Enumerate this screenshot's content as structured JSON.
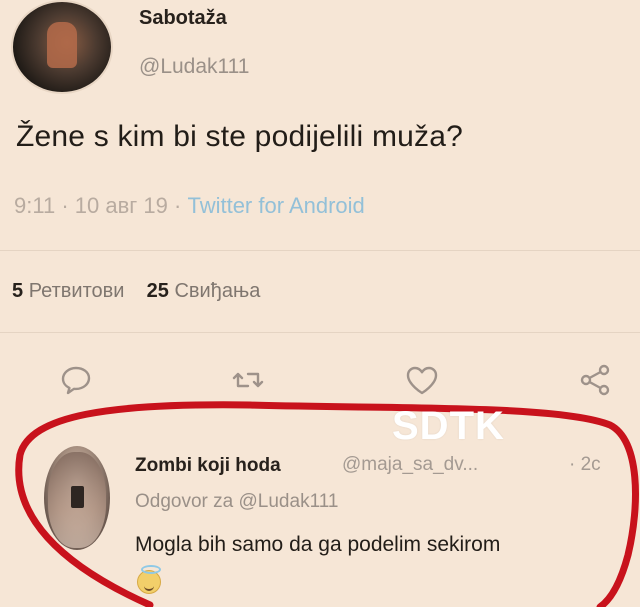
{
  "tweet": {
    "display_name": "Sabotaža",
    "handle": "@Ludak111",
    "text": "Žene s kim bi ste podijelili muža?",
    "time": "9:11",
    "date": "10 авг 19",
    "source": "Twitter for Android",
    "retweets_count": "5",
    "retweets_label": "Ретвитови",
    "likes_count": "25",
    "likes_label": "Свиђања"
  },
  "actions": [
    {
      "icon": "reply-icon"
    },
    {
      "icon": "retweet-icon"
    },
    {
      "icon": "like-icon"
    },
    {
      "icon": "share-icon"
    }
  ],
  "watermark": "SDTK",
  "reply": {
    "display_name": "Zombi koji hoda",
    "handle": "@maja_sa_dv...",
    "time": "· 2c",
    "replying_to_label": "Odgovor za",
    "replying_to_handle": "@Ludak111",
    "text": "Mogla bih samo da ga podelim sekirom",
    "emoji": "smiling-face-with-halo"
  },
  "colors": {
    "background": "#f6e6d6",
    "annotation": "#c8121c",
    "link": "#93c0d8"
  }
}
